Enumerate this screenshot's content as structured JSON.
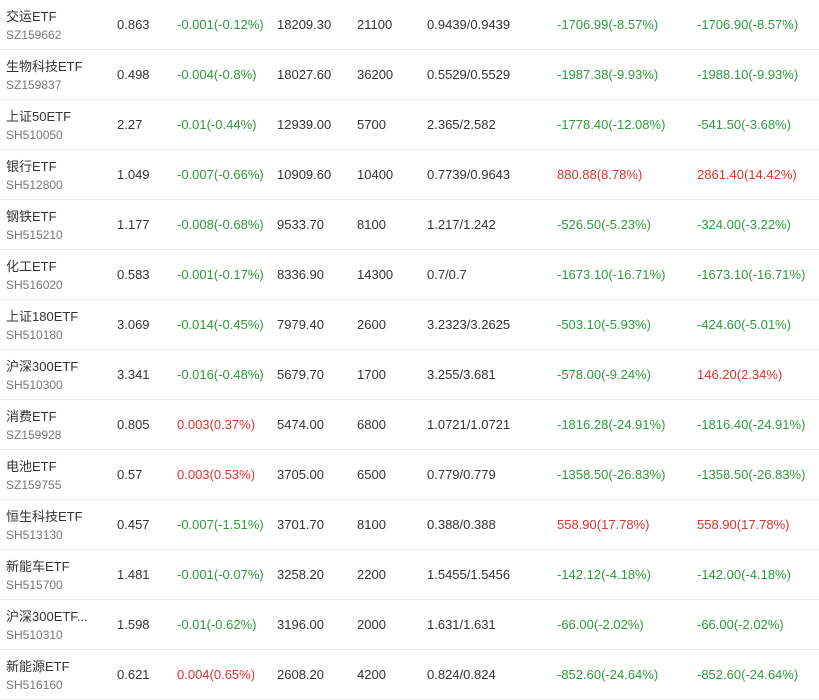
{
  "colors": {
    "up": "#e0312c",
    "down": "#2e9a3c",
    "text": "#333333",
    "sub": "#777777"
  },
  "rows": [
    {
      "name": "交运ETF",
      "code": "SZ159662",
      "price": "0.863",
      "change": "-0.001(-0.12%)",
      "change_dir": "down",
      "amount": "18209.30",
      "volume": "21100",
      "range": "0.9439/0.9439",
      "pl1": "-1706.99(-8.57%)",
      "pl1_dir": "down",
      "pl2": "-1706.90(-8.57%)",
      "pl2_dir": "down"
    },
    {
      "name": "生物科技ETF",
      "code": "SZ159837",
      "price": "0.498",
      "change": "-0.004(-0.8%)",
      "change_dir": "down",
      "amount": "18027.60",
      "volume": "36200",
      "range": "0.5529/0.5529",
      "pl1": "-1987.38(-9.93%)",
      "pl1_dir": "down",
      "pl2": "-1988.10(-9.93%)",
      "pl2_dir": "down"
    },
    {
      "name": "上证50ETF",
      "code": "SH510050",
      "price": "2.27",
      "change": "-0.01(-0.44%)",
      "change_dir": "down",
      "amount": "12939.00",
      "volume": "5700",
      "range": "2.365/2.582",
      "pl1": "-1778.40(-12.08%)",
      "pl1_dir": "down",
      "pl2": "-541.50(-3.68%)",
      "pl2_dir": "down"
    },
    {
      "name": "银行ETF",
      "code": "SH512800",
      "price": "1.049",
      "change": "-0.007(-0.66%)",
      "change_dir": "down",
      "amount": "10909.60",
      "volume": "10400",
      "range": "0.7739/0.9643",
      "pl1": "880.88(8.78%)",
      "pl1_dir": "up",
      "pl2": "2861.40(14.42%)",
      "pl2_dir": "up"
    },
    {
      "name": "钢铁ETF",
      "code": "SH515210",
      "price": "1.177",
      "change": "-0.008(-0.68%)",
      "change_dir": "down",
      "amount": "9533.70",
      "volume": "8100",
      "range": "1.217/1.242",
      "pl1": "-526.50(-5.23%)",
      "pl1_dir": "down",
      "pl2": "-324.00(-3.22%)",
      "pl2_dir": "down"
    },
    {
      "name": "化工ETF",
      "code": "SH516020",
      "price": "0.583",
      "change": "-0.001(-0.17%)",
      "change_dir": "down",
      "amount": "8336.90",
      "volume": "14300",
      "range": "0.7/0.7",
      "pl1": "-1673.10(-16.71%)",
      "pl1_dir": "down",
      "pl2": "-1673.10(-16.71%)",
      "pl2_dir": "down"
    },
    {
      "name": "上证180ETF",
      "code": "SH510180",
      "price": "3.069",
      "change": "-0.014(-0.45%)",
      "change_dir": "down",
      "amount": "7979.40",
      "volume": "2600",
      "range": "3.2323/3.2625",
      "pl1": "-503.10(-5.93%)",
      "pl1_dir": "down",
      "pl2": "-424.60(-5.01%)",
      "pl2_dir": "down"
    },
    {
      "name": "沪深300ETF",
      "code": "SH510300",
      "price": "3.341",
      "change": "-0.016(-0.48%)",
      "change_dir": "down",
      "amount": "5679.70",
      "volume": "1700",
      "range": "3.255/3.681",
      "pl1": "-578.00(-9.24%)",
      "pl1_dir": "down",
      "pl2": "146.20(2.34%)",
      "pl2_dir": "up"
    },
    {
      "name": "消费ETF",
      "code": "SZ159928",
      "price": "0.805",
      "change": "0.003(0.37%)",
      "change_dir": "up",
      "amount": "5474.00",
      "volume": "6800",
      "range": "1.0721/1.0721",
      "pl1": "-1816.28(-24.91%)",
      "pl1_dir": "down",
      "pl2": "-1816.40(-24.91%)",
      "pl2_dir": "down"
    },
    {
      "name": "电池ETF",
      "code": "SZ159755",
      "price": "0.57",
      "change": "0.003(0.53%)",
      "change_dir": "up",
      "amount": "3705.00",
      "volume": "6500",
      "range": "0.779/0.779",
      "pl1": "-1358.50(-26.83%)",
      "pl1_dir": "down",
      "pl2": "-1358.50(-26.83%)",
      "pl2_dir": "down"
    },
    {
      "name": "恒生科技ETF",
      "code": "SH513130",
      "price": "0.457",
      "change": "-0.007(-1.51%)",
      "change_dir": "down",
      "amount": "3701.70",
      "volume": "8100",
      "range": "0.388/0.388",
      "pl1": "558.90(17.78%)",
      "pl1_dir": "up",
      "pl2": "558.90(17.78%)",
      "pl2_dir": "up"
    },
    {
      "name": "新能车ETF",
      "code": "SH515700",
      "price": "1.481",
      "change": "-0.001(-0.07%)",
      "change_dir": "down",
      "amount": "3258.20",
      "volume": "2200",
      "range": "1.5455/1.5456",
      "pl1": "-142.12(-4.18%)",
      "pl1_dir": "down",
      "pl2": "-142.00(-4.18%)",
      "pl2_dir": "down"
    },
    {
      "name": "沪深300ETF...",
      "code": "SH510310",
      "price": "1.598",
      "change": "-0.01(-0.62%)",
      "change_dir": "down",
      "amount": "3196.00",
      "volume": "2000",
      "range": "1.631/1.631",
      "pl1": "-66.00(-2.02%)",
      "pl1_dir": "down",
      "pl2": "-66.00(-2.02%)",
      "pl2_dir": "down"
    },
    {
      "name": "新能源ETF",
      "code": "SH516160",
      "price": "0.621",
      "change": "0.004(0.65%)",
      "change_dir": "up",
      "amount": "2608.20",
      "volume": "4200",
      "range": "0.824/0.824",
      "pl1": "-852.60(-24.64%)",
      "pl1_dir": "down",
      "pl2": "-852.60(-24.64%)",
      "pl2_dir": "down"
    }
  ]
}
